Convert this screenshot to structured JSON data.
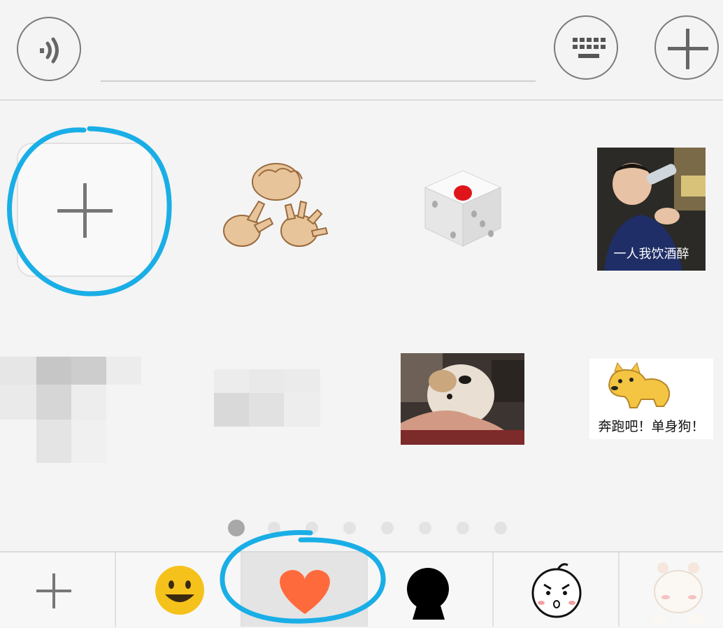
{
  "toolbar": {
    "voice_icon": "voice-icon",
    "keyboard_icon": "keyboard-icon",
    "more_icon": "plus-icon",
    "input_value": ""
  },
  "stickers": {
    "row1": [
      {
        "name": "add-sticker",
        "icon": "plus-icon"
      },
      {
        "name": "rock-paper-scissors",
        "icon": "hands-icon"
      },
      {
        "name": "dice",
        "icon": "dice-icon"
      },
      {
        "name": "drinking-baby",
        "caption": "一人我饮酒醉"
      }
    ],
    "row2": [
      {
        "name": "blurred-sticker-1"
      },
      {
        "name": "blurred-sticker-2"
      },
      {
        "name": "dog-face-photo"
      },
      {
        "name": "doge-running",
        "caption": "奔跑吧！单身狗！"
      }
    ]
  },
  "pagination": {
    "pages": 8,
    "current": 1
  },
  "tabs": [
    {
      "name": "add-tab",
      "icon": "plus-icon"
    },
    {
      "name": "emoji-tab",
      "icon": "smiley-icon"
    },
    {
      "name": "favorites-tab",
      "icon": "heart-icon",
      "selected": true
    },
    {
      "name": "silhouette-tab",
      "icon": "person-icon"
    },
    {
      "name": "cartoon-face-tab",
      "icon": "angry-face-icon"
    },
    {
      "name": "cat-tab",
      "icon": "cat-icon"
    }
  ],
  "colors": {
    "accent_annotation": "#1aaee6",
    "heart": "#ff6a3d",
    "smiley": "#f5c21b",
    "dice_pip": "#e0151b"
  }
}
